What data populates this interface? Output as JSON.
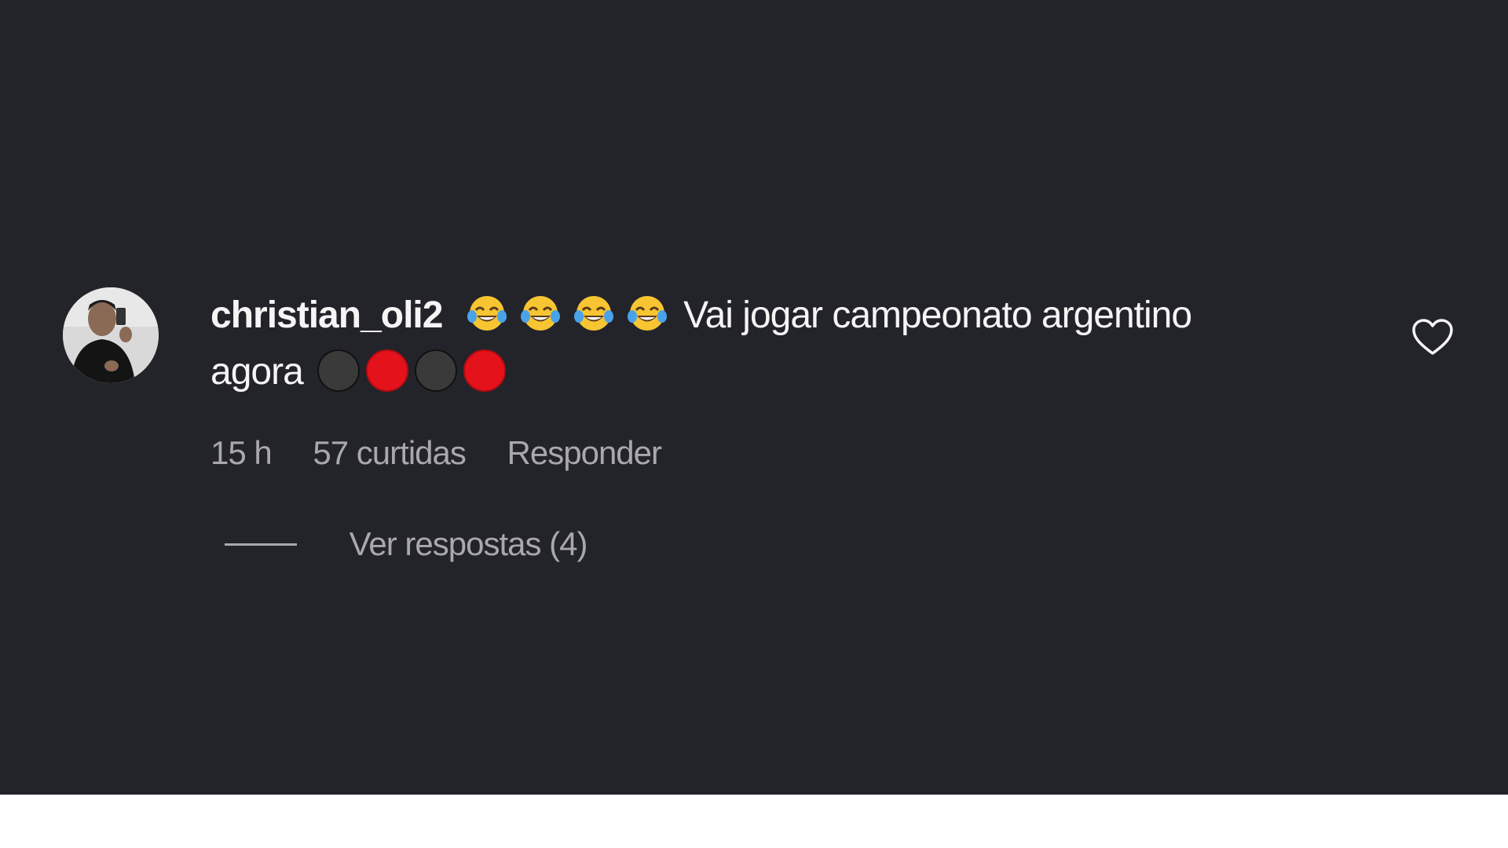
{
  "comment": {
    "username": "christian_oli2",
    "text_line1": "Vai jogar campeonato argentino",
    "text_line2": "agora",
    "emojis": [
      "face-with-tears-of-joy-emoji",
      "face-with-tears-of-joy-emoji",
      "face-with-tears-of-joy-emoji",
      "face-with-tears-of-joy-emoji"
    ],
    "circle_emojis": [
      "black-circle",
      "red-circle",
      "black-circle",
      "red-circle"
    ],
    "time": "15 h",
    "likes": "57 curtidas",
    "reply_label": "Responder",
    "view_replies_label": "Ver respostas (4)",
    "like_icon": "heart-outline-icon"
  },
  "colors": {
    "background": "#23232a",
    "text": "#f5f5f5",
    "secondary_text": "#a8a8ad",
    "red_circle": "#e3121b",
    "black_circle": "#3a3a3a"
  }
}
